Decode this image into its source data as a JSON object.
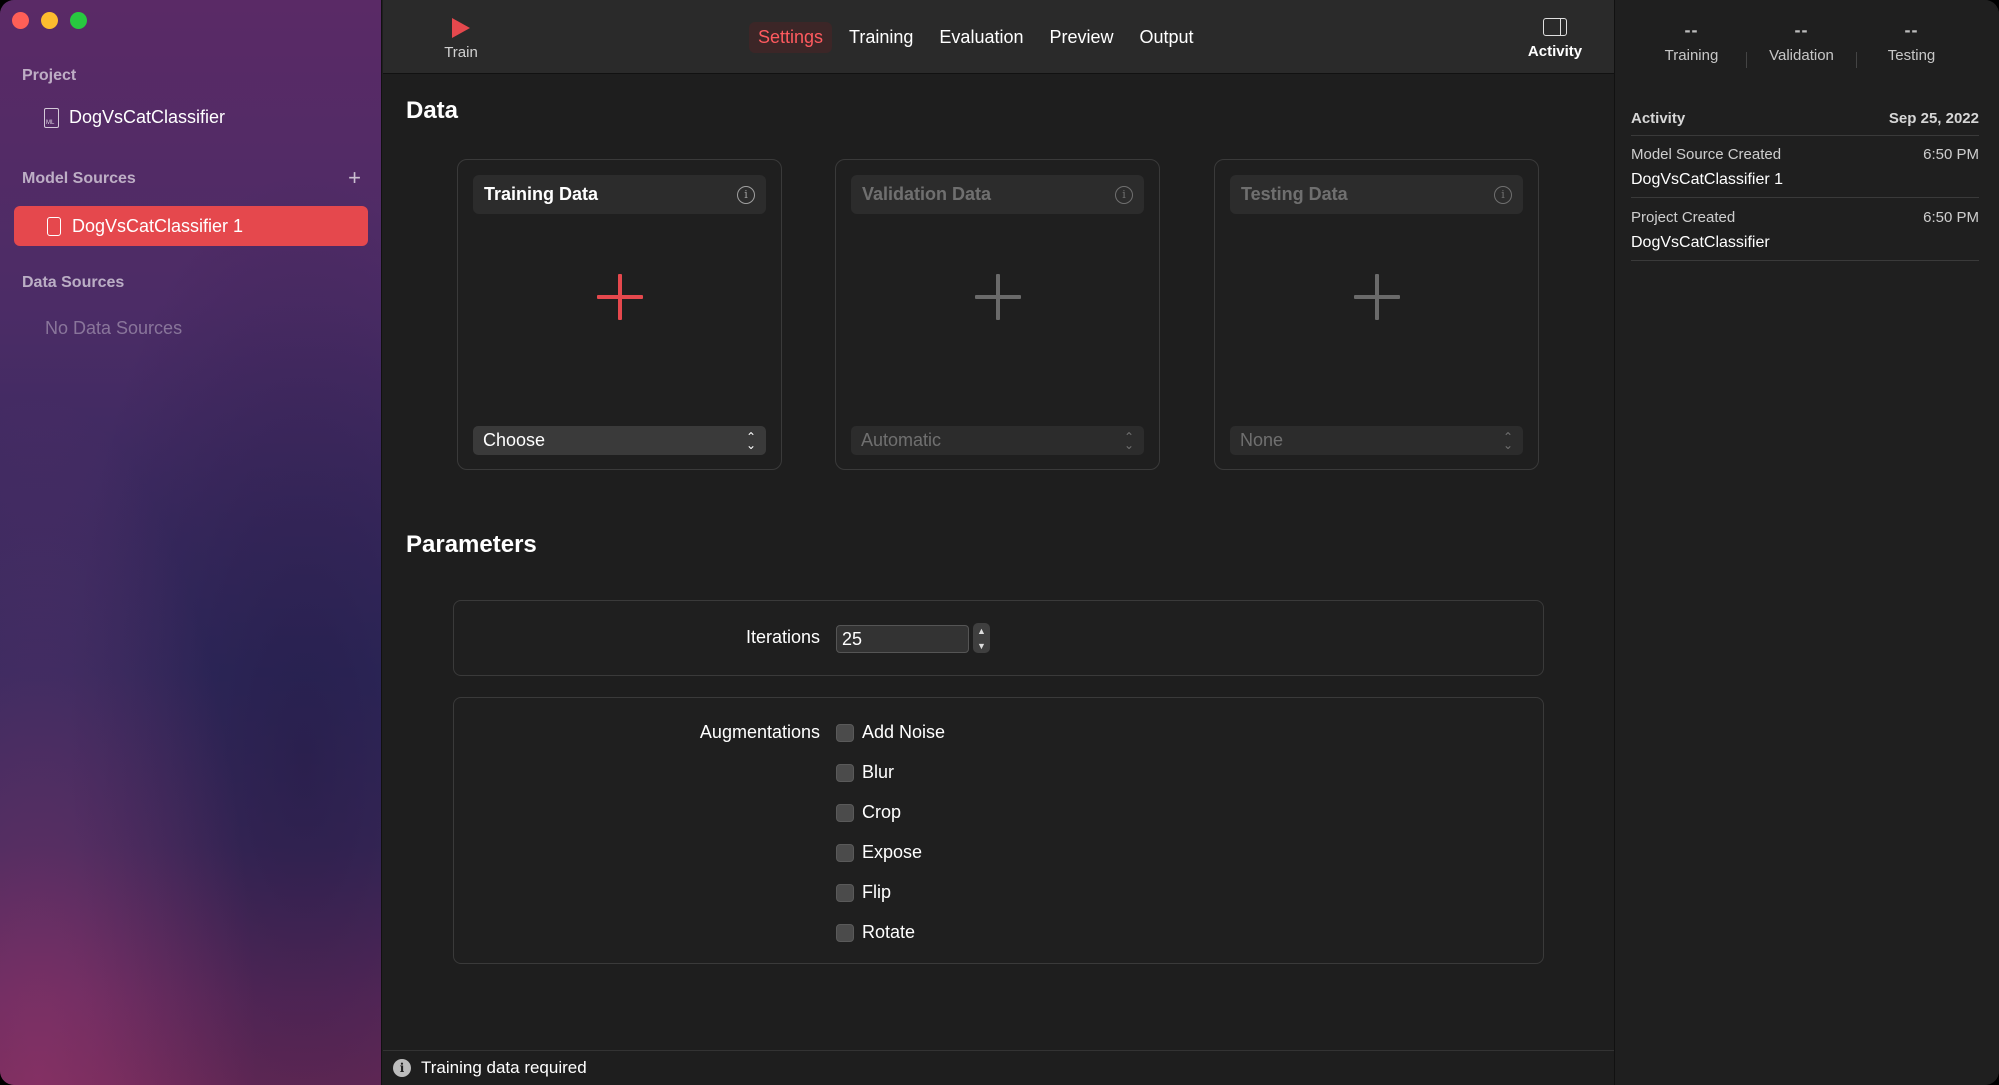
{
  "sidebar": {
    "project_heading": "Project",
    "project_name": "DogVsCatClassifier",
    "model_sources_heading": "Model Sources",
    "add_symbol": "+",
    "selected_model": "DogVsCatClassifier 1",
    "data_sources_heading": "Data Sources",
    "data_sources_empty": "No Data Sources"
  },
  "toolbar": {
    "train_label": "Train",
    "tabs": [
      "Settings",
      "Training",
      "Evaluation",
      "Preview",
      "Output"
    ],
    "active_tab": "Settings",
    "activity_label": "Activity"
  },
  "main": {
    "data_heading": "Data",
    "cards": [
      {
        "title": "Training Data",
        "select_value": "Choose",
        "enabled": true
      },
      {
        "title": "Validation Data",
        "select_value": "Automatic",
        "enabled": false
      },
      {
        "title": "Testing Data",
        "select_value": "None",
        "enabled": false
      }
    ],
    "parameters_heading": "Parameters",
    "iterations_label": "Iterations",
    "iterations_value": "25",
    "augmentations_label": "Augmentations",
    "augmentations": [
      "Add Noise",
      "Blur",
      "Crop",
      "Expose",
      "Flip",
      "Rotate"
    ]
  },
  "status": {
    "message": "Training data required"
  },
  "right_panel": {
    "stats": [
      {
        "value": "--",
        "label": "Training"
      },
      {
        "value": "--",
        "label": "Validation"
      },
      {
        "value": "--",
        "label": "Testing"
      }
    ],
    "activity_heading": "Activity",
    "activity_date": "Sep 25, 2022",
    "entries": [
      {
        "event": "Model Source Created",
        "time": "6:50 PM",
        "name": "DogVsCatClassifier 1"
      },
      {
        "event": "Project Created",
        "time": "6:50 PM",
        "name": "DogVsCatClassifier"
      }
    ]
  },
  "colors": {
    "accent": "#e5484d",
    "active_tab_text": "#ff5a5f"
  }
}
